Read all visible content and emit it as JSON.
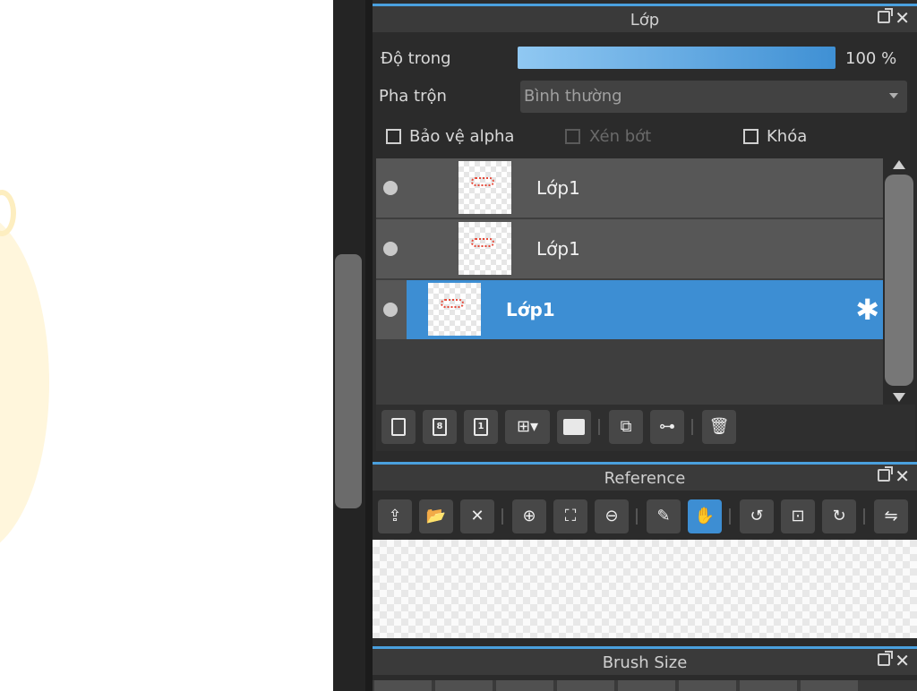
{
  "layer_panel": {
    "title": "Lớp",
    "opacity": {
      "label": "Độ trong",
      "value": 100,
      "value_text": "100 %"
    },
    "blend": {
      "label": "Pha trộn",
      "value": "Bình thường"
    },
    "options": {
      "protect_alpha": "Bảo vệ alpha",
      "clipping": "Xén bớt",
      "lock": "Khóa"
    },
    "layers": [
      {
        "name": "Lớp1",
        "selected": false
      },
      {
        "name": "Lớp1",
        "selected": false
      },
      {
        "name": "Lớp1",
        "selected": true
      }
    ],
    "toolbar_icons": [
      "new-layer-icon",
      "new-8bit-layer-icon",
      "new-1bit-layer-icon",
      "add-layer-menu-icon",
      "new-folder-icon",
      "duplicate-layer-icon",
      "merge-down-icon",
      "delete-layer-icon"
    ]
  },
  "reference_panel": {
    "title": "Reference",
    "toolbar_icons": [
      "upload-icon",
      "open-folder-icon",
      "close-icon",
      "zoom-in-icon",
      "fit-icon",
      "zoom-out-icon",
      "eyedropper-icon",
      "hand-icon",
      "rotate-left-icon",
      "fit-screen-icon",
      "rotate-right-icon",
      "flip-icon"
    ],
    "active_tool": "hand-icon"
  },
  "brush_panel": {
    "title": "Brush Size"
  },
  "colors": {
    "accent": "#3d8ed3",
    "panel_bg": "#2b2b2b",
    "titlebar_bg": "#3a3a3a"
  }
}
